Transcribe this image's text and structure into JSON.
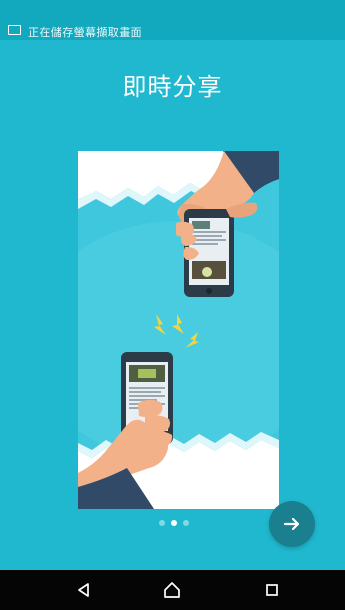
{
  "status": {
    "notification_text": "正在儲存螢幕擷取畫面"
  },
  "page": {
    "headline": "即時分享"
  },
  "illustration": {
    "name": "instant-share-illustration"
  },
  "pager": {
    "count": 3,
    "active_index": 1
  },
  "actions": {
    "next": "next-arrow"
  },
  "navigation": {
    "back": "back-icon",
    "home": "home-icon",
    "recents": "recents-icon"
  }
}
